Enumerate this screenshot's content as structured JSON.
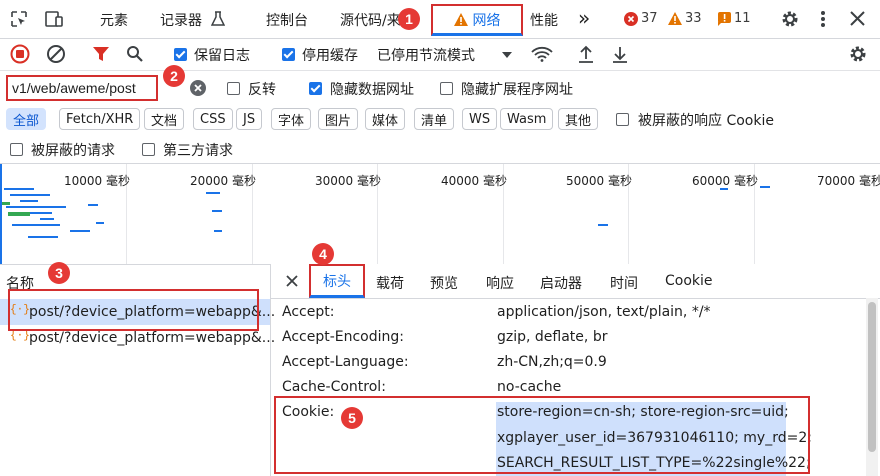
{
  "topbar": {
    "tabs": [
      "元素",
      "记录器",
      "控制台",
      "源代码/来",
      "网络",
      "性能"
    ],
    "more": "»",
    "errors": "37",
    "warnings": "33",
    "issues": "11"
  },
  "toolbar": {
    "preserve_log": "保留日志",
    "disable_cache": "停用缓存",
    "throttle": "已停用节流模式"
  },
  "filter": {
    "value": "v1/web/aweme/post",
    "invert": "反转",
    "hide_data_urls": "隐藏数据网址",
    "hide_ext_urls": "隐藏扩展程序网址"
  },
  "types": [
    "全部",
    "Fetch/XHR",
    "文档",
    "CSS",
    "JS",
    "字体",
    "图片",
    "媒体",
    "清单",
    "WS",
    "Wasm",
    "其他"
  ],
  "blocked_response_cookies": "被屏蔽的响应 Cookie",
  "blocked_requests": "被屏蔽的请求",
  "third_party": "第三方请求",
  "timeline": {
    "ticks": [
      "10000 毫秒",
      "20000 毫秒",
      "30000 毫秒",
      "40000 毫秒",
      "50000 毫秒",
      "60000 毫秒",
      "70000 毫秒"
    ]
  },
  "requests": {
    "column_name": "名称",
    "items": [
      "post/?device_platform=webapp&...",
      "post/?device_platform=webapp&..."
    ]
  },
  "detail": {
    "tabs": [
      "标头",
      "载荷",
      "预览",
      "响应",
      "启动器",
      "时间",
      "Cookie"
    ],
    "headers": [
      {
        "name": "Accept:",
        "value": "application/json, text/plain, */*"
      },
      {
        "name": "Accept-Encoding:",
        "value": "gzip, deflate, br"
      },
      {
        "name": "Accept-Language:",
        "value": "zh-CN,zh;q=0.9"
      },
      {
        "name": "Cache-Control:",
        "value": "no-cache"
      },
      {
        "name": "Cookie:",
        "value": "store-region=cn-sh; store-region-src=uid;"
      }
    ],
    "cookie_cont": [
      "xgplayer_user_id=367931046110; my_rd=2;",
      "SEARCH_RESULT_LIST_TYPE=%22single%22;"
    ]
  },
  "steps": [
    "1",
    "2",
    "3",
    "4",
    "5"
  ],
  "colors": {
    "accent": "#1a73e8",
    "highlight_red": "#d32f2f",
    "selection": "#cfe0fc"
  }
}
